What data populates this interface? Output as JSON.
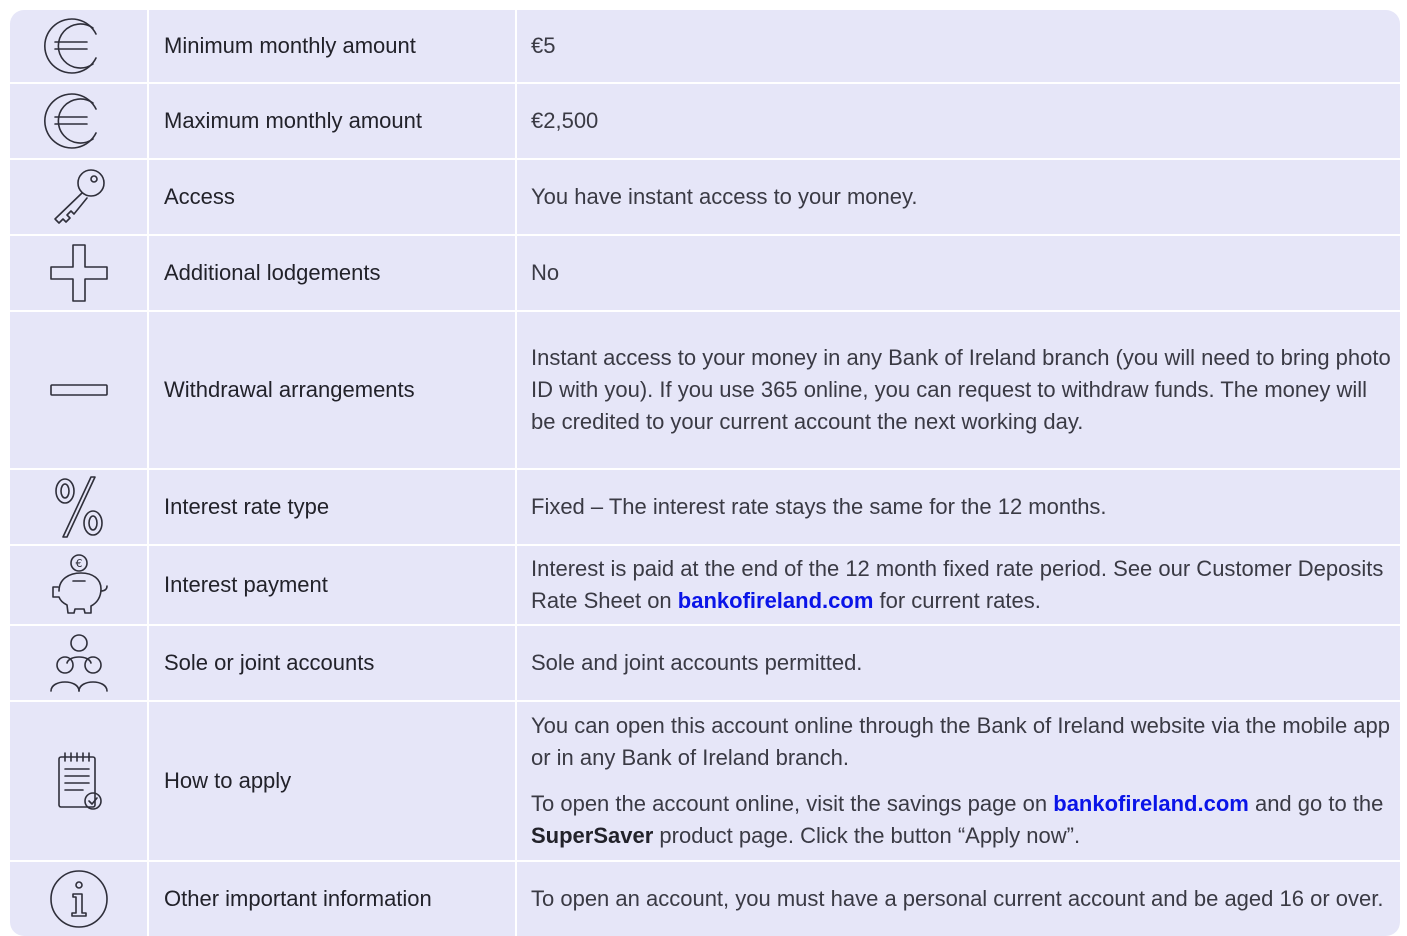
{
  "rows": [
    {
      "icon": "euro-icon",
      "label": "Minimum monthly amount",
      "value": "€5"
    },
    {
      "icon": "euro-icon",
      "label": "Maximum monthly amount",
      "value": "€2,500"
    },
    {
      "icon": "key-icon",
      "label": "Access",
      "value": "You have instant access to your money."
    },
    {
      "icon": "plus-icon",
      "label": "Additional lodgements",
      "value": "No"
    },
    {
      "icon": "minus-icon",
      "label": "Withdrawal arrangements",
      "value": "Instant access to your money in any Bank of Ireland branch (you will need to bring photo ID with you). If you use 365 online, you can request to withdraw funds. The money will be credited to your current account the next working day."
    },
    {
      "icon": "percent-icon",
      "label": "Interest rate type",
      "value": "Fixed – The interest rate stays the same for the 12 months."
    },
    {
      "icon": "piggy-bank-icon",
      "label": "Interest payment",
      "value_pre": "Interest is paid at the end of the 12 month fixed rate period. See our Customer Deposits Rate Sheet on ",
      "value_link": "bankofireland.com",
      "value_post": " for current rates."
    },
    {
      "icon": "people-icon",
      "label": "Sole or joint accounts",
      "value": "Sole and joint accounts permitted."
    },
    {
      "icon": "checklist-icon",
      "label": "How to apply",
      "p1": "You can open this account online through the Bank of Ireland website via the mobile app or in any Bank of Ireland branch.",
      "p2_pre": "To open the account online, visit the savings page on ",
      "p2_link": "bankofireland.com",
      "p2_mid": " and go to the ",
      "p2_bold": "SuperSaver",
      "p2_post": " product page. Click the button “Apply now”."
    },
    {
      "icon": "info-icon",
      "label": "Other important information",
      "value": "To open an account, you must have a personal current account and be aged 16 or over."
    }
  ]
}
